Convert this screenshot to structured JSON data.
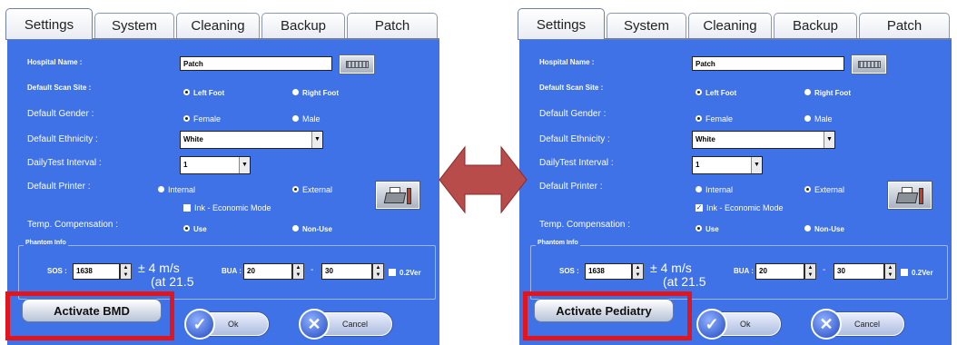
{
  "tabs": [
    "Settings",
    "System",
    "Cleaning",
    "Backup",
    "Patch"
  ],
  "form": {
    "hospital_name_label": "Hospital Name :",
    "hospital_name_value": "Patch",
    "scan_site_label": "Default Scan Site :",
    "left_foot": "Left Foot",
    "right_foot": "Right Foot",
    "gender_label": "Default Gender :",
    "female": "Female",
    "male": "Male",
    "ethnicity_label": "Default Ethnicity :",
    "ethnicity_value": "White",
    "dailytest_label": "DailyTest Interval :",
    "dailytest_value": "1",
    "printer_label": "Default Printer :",
    "internal": "Internal",
    "external": "External",
    "ink_economic": "Ink - Economic Mode",
    "temp_label": "Temp. Compensation :",
    "use": "Use",
    "non_use": "Non-Use"
  },
  "phantom": {
    "legend": "Phantom Info",
    "sos_label": "SOS :",
    "sos_value": "1638",
    "tolerance_line1": "± 4 m/s",
    "tolerance_line2": "(at 21.5",
    "bua_label": "BUA :",
    "bua_min": "20",
    "dash": "-",
    "bua_max": "30",
    "ver_label": "0.2Ver"
  },
  "buttons": {
    "ok": "Ok",
    "cancel": "Cancel",
    "ok_icon": "checkmark-icon",
    "cancel_icon": "x-icon"
  },
  "left_window": {
    "activate_label": "Activate BMD",
    "ink_checked": false
  },
  "right_window": {
    "activate_label": "Activate Pediatry",
    "ink_checked": true
  },
  "colors": {
    "panel_blue": "#3f72e6",
    "highlight_red": "#e2141c",
    "arrow_fill": "#b84c4a"
  }
}
